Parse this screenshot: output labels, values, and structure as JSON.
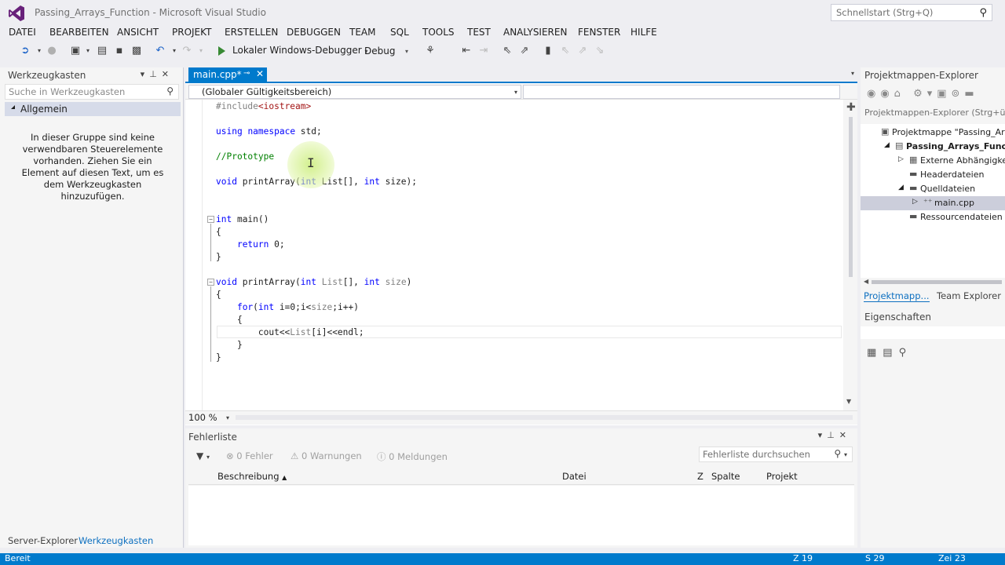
{
  "window": {
    "title": "Passing_Arrays_Function - Microsoft Visual Studio",
    "quicklaunch_placeholder": "Schnellstart (Strg+Q)"
  },
  "menu": [
    "DATEI",
    "BEARBEITEN",
    "ANSICHT",
    "PROJEKT",
    "ERSTELLEN",
    "DEBUGGEN",
    "TEAM",
    "SQL",
    "TOOLS",
    "TEST",
    "ANALYSIEREN",
    "FENSTER",
    "HILFE"
  ],
  "toolbar": {
    "run_label": "Lokaler Windows-Debugger",
    "config": "Debug"
  },
  "toolbox": {
    "title": "Werkzeugkasten",
    "search_placeholder": "Suche in Werkzeugkasten",
    "group": "Allgemein",
    "empty_text": "In dieser Gruppe sind keine verwendbaren Steuerelemente vorhanden. Ziehen Sie ein Element auf diesen Text, um es dem Werkzeugkasten hinzuzufügen."
  },
  "editor": {
    "tab": "main.cpp*",
    "scope": "(Globaler Gültigkeitsbereich)",
    "zoom": "100 %"
  },
  "code_lines": [
    {
      "tokens": [
        {
          "t": "#include",
          "c": "pp"
        },
        {
          "t": "<iostream>",
          "c": "inc"
        }
      ]
    },
    {
      "tokens": []
    },
    {
      "tokens": [
        {
          "t": "using",
          "c": "kw"
        },
        {
          "t": " "
        },
        {
          "t": "namespace",
          "c": "kw"
        },
        {
          "t": " std;"
        }
      ]
    },
    {
      "tokens": []
    },
    {
      "tokens": [
        {
          "t": "//Prototype",
          "c": "cm"
        }
      ]
    },
    {
      "tokens": []
    },
    {
      "tokens": [
        {
          "t": "void",
          "c": "kw"
        },
        {
          "t": " printArray("
        },
        {
          "t": "int",
          "c": "kw"
        },
        {
          "t": " List[], "
        },
        {
          "t": "int",
          "c": "kw"
        },
        {
          "t": " size);"
        }
      ]
    },
    {
      "tokens": []
    },
    {
      "tokens": []
    },
    {
      "tokens": [
        {
          "t": "int",
          "c": "kw"
        },
        {
          "t": " main()"
        }
      ]
    },
    {
      "tokens": [
        {
          "t": "{"
        }
      ]
    },
    {
      "tokens": [
        {
          "t": "    "
        },
        {
          "t": "return",
          "c": "kw"
        },
        {
          "t": " 0;"
        }
      ]
    },
    {
      "tokens": [
        {
          "t": "}"
        }
      ]
    },
    {
      "tokens": []
    },
    {
      "tokens": [
        {
          "t": "void",
          "c": "kw"
        },
        {
          "t": " printArray("
        },
        {
          "t": "int",
          "c": "kw"
        },
        {
          "t": " "
        },
        {
          "t": "List",
          "c": "par"
        },
        {
          "t": "[], "
        },
        {
          "t": "int",
          "c": "kw"
        },
        {
          "t": " "
        },
        {
          "t": "size",
          "c": "par"
        },
        {
          "t": ")"
        }
      ]
    },
    {
      "tokens": [
        {
          "t": "{"
        }
      ]
    },
    {
      "tokens": [
        {
          "t": "    "
        },
        {
          "t": "for",
          "c": "kw"
        },
        {
          "t": "("
        },
        {
          "t": "int",
          "c": "kw"
        },
        {
          "t": " i=0;i<"
        },
        {
          "t": "size",
          "c": "par"
        },
        {
          "t": ";i++)"
        }
      ]
    },
    {
      "tokens": [
        {
          "t": "    {"
        }
      ]
    },
    {
      "tokens": [
        {
          "t": "        cout<<"
        },
        {
          "t": "List",
          "c": "par"
        },
        {
          "t": "[i]<<endl;"
        }
      ]
    },
    {
      "tokens": [
        {
          "t": "    }"
        }
      ]
    },
    {
      "tokens": [
        {
          "t": "}"
        }
      ]
    }
  ],
  "errorlist": {
    "title": "Fehlerliste",
    "errors": "0 Fehler",
    "warnings": "0 Warnungen",
    "messages": "0 Meldungen",
    "search_placeholder": "Fehlerliste durchsuchen",
    "columns": [
      "Beschreibung",
      "Datei",
      "Z",
      "Spalte",
      "Projekt"
    ]
  },
  "solution": {
    "title": "Projektmappen-Explorer",
    "search_placeholder": "Projektmappen-Explorer (Strg+ü)",
    "tree": [
      {
        "label": "Projektmappe \"Passing_Arra",
        "indent": 0,
        "arrow": "",
        "icon": "▣",
        "bold": false,
        "selected": false
      },
      {
        "label": "Passing_Arrays_Function",
        "indent": 1,
        "arrow": "◢",
        "icon": "▤",
        "bold": true,
        "selected": false
      },
      {
        "label": "Externe Abhängigkeit",
        "indent": 2,
        "arrow": "▷",
        "icon": "▦",
        "bold": false,
        "selected": false
      },
      {
        "label": "Headerdateien",
        "indent": 2,
        "arrow": "",
        "icon": "▬",
        "bold": false,
        "selected": false
      },
      {
        "label": "Quelldateien",
        "indent": 2,
        "arrow": "◢",
        "icon": "▬",
        "bold": false,
        "selected": false
      },
      {
        "label": "main.cpp",
        "indent": 3,
        "arrow": "▷",
        "icon": "⁺⁺",
        "bold": false,
        "selected": true
      },
      {
        "label": "Ressourcendateien",
        "indent": 2,
        "arrow": "",
        "icon": "▬",
        "bold": false,
        "selected": false
      }
    ],
    "tab_active": "Projektmapp...",
    "tab_other": "Team Explorer"
  },
  "properties": {
    "title": "Eigenschaften"
  },
  "bottom_tabs": {
    "server": "Server-Explorer",
    "toolbox": "Werkzeugkasten"
  },
  "status": {
    "ready": "Bereit",
    "line": "Z 19",
    "col": "S 29",
    "char": "Zei 23"
  },
  "colors": {
    "accent": "#007acc",
    "keyword": "#0000ff",
    "comment": "#008000",
    "string": "#a31515"
  }
}
